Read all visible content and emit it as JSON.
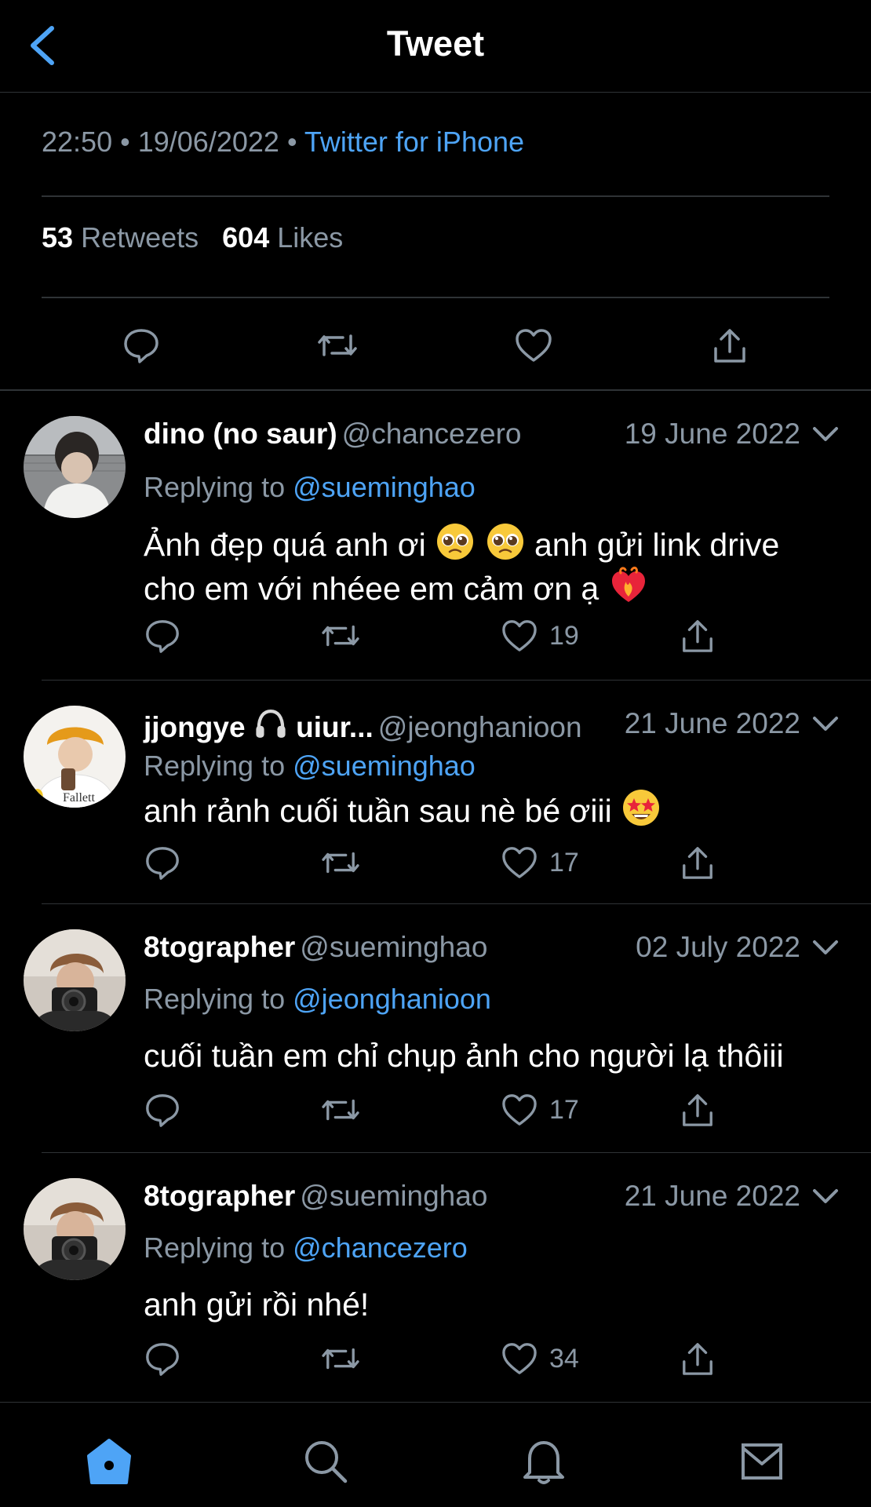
{
  "header": {
    "title": "Tweet"
  },
  "tweet_meta": {
    "time": "22:50",
    "date": "19/06/2022",
    "separator": "•",
    "source": "Twitter for iPhone"
  },
  "stats": {
    "retweets_count": "53",
    "retweets_label": "Retweets",
    "likes_count": "604",
    "likes_label": "Likes"
  },
  "replies": [
    {
      "name": "dino (no saur)",
      "handle": "@chancezero",
      "date": "19 June 2022",
      "replying_label": "Replying to",
      "replying_to": "@sueminghao",
      "text_parts": [
        "Ảnh đẹp quá anh ơi",
        "anh gửi link drive cho em với nhéee em cảm ơn ạ"
      ],
      "likes": "19",
      "emojis": [
        "pleading-face",
        "pleading-face",
        "heart-on-fire"
      ]
    },
    {
      "name": "jjongye",
      "name_suffix": "uiur...",
      "handle": "@jeonghanioon",
      "date": "21 June 2022",
      "replying_label": "Replying to",
      "replying_to": "@sueminghao",
      "text": "anh rảnh cuối tuần sau nè bé ơiii",
      "likes": "17",
      "emojis": [
        "headphones",
        "star-struck"
      ]
    },
    {
      "name": "8tographer",
      "handle": "@sueminghao",
      "date": "02 July 2022",
      "replying_label": "Replying to",
      "replying_to": "@jeonghanioon",
      "text": "cuối tuần em chỉ chụp ảnh cho người lạ thôiii",
      "likes": "17"
    },
    {
      "name": "8tographer",
      "handle": "@sueminghao",
      "date": "21 June 2022",
      "replying_label": "Replying to",
      "replying_to": "@chancezero",
      "text": "anh gửi rồi nhé!",
      "likes": "34"
    }
  ],
  "colors": {
    "accent": "#4ea4f6",
    "muted": "#8b98a5",
    "divider": "#2f3336",
    "background": "#000000"
  },
  "tabs": [
    "home-icon",
    "search-icon",
    "bell-icon",
    "mail-icon"
  ]
}
